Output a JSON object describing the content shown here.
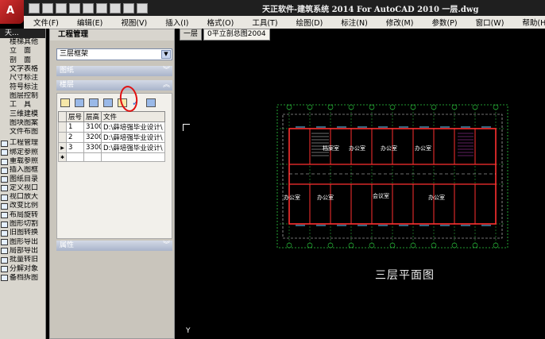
{
  "logo": {
    "letter": "A"
  },
  "title": "天正软件-建筑系统 2014  For AutoCAD 2010  一层.dwg",
  "menu": [
    "文件(F)",
    "编辑(E)",
    "视图(V)",
    "插入(I)",
    "格式(O)",
    "工具(T)",
    "绘图(D)",
    "标注(N)",
    "修改(M)",
    "参数(P)",
    "窗口(W)",
    "帮助(H)"
  ],
  "left_toolbar": {
    "header": "天...",
    "items": [
      "楼梯其他",
      "立　面",
      "剖　面",
      "文字表格",
      "尺寸标注",
      "符号标注",
      "图层控制",
      "工　具",
      "三维建模",
      "图块图案",
      "文件布图"
    ],
    "icon_items": [
      "工程管理",
      "绑定参照",
      "重载参照",
      "插入图框",
      "图纸目录",
      "定义视口",
      "视口放大",
      "改变比例",
      "布局旋转",
      "图形切割",
      "旧图转换",
      "图形导出",
      "局部导出",
      "批量转旧",
      "分解对象",
      "备档拆图"
    ]
  },
  "panel": {
    "title": "工程管理",
    "project": "三层框架",
    "sections": {
      "drawings": "图纸",
      "floors": "楼层",
      "properties": "属性"
    },
    "table": {
      "headers": [
        "层号",
        "层高",
        "文件"
      ],
      "rows": [
        [
          "1",
          "3100",
          "D:\\薛培强毕业设计\\"
        ],
        [
          "2",
          "3200",
          "D:\\薛培强毕业设计\\"
        ],
        [
          "3",
          "3300",
          "D:\\薛培强毕业设计\\"
        ]
      ]
    }
  },
  "tabs": [
    "一层",
    "0平立剖总图2004"
  ],
  "drawing": {
    "plan_title": "三层平面图",
    "rooms": [
      "档案室",
      "办公室",
      "办公室",
      "办公室",
      "办公室",
      "办公室",
      "会议室",
      "办公室"
    ],
    "axis_label": "Y"
  },
  "colors": {
    "grid": "#2ecc40",
    "walls": "#ff3030",
    "dims": "#dddddd",
    "highlight": "#e01010"
  }
}
